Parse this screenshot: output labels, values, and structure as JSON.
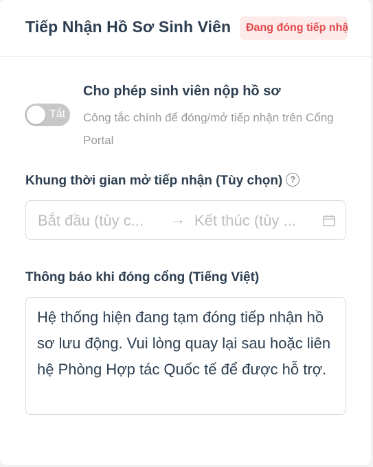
{
  "header": {
    "title": "Tiếp Nhận Hồ Sơ Sinh Viên",
    "status_badge": "Đang đóng tiếp nhận"
  },
  "toggle": {
    "state_label": "Tắt",
    "is_on": false
  },
  "option": {
    "title": "Cho phép sinh viên nộp hồ sơ",
    "description": "Công tắc chính để đóng/mở tiếp nhận trên Cổng Portal"
  },
  "time_window": {
    "label": "Khung thời gian mở tiếp nhận (Tùy chọn)",
    "start_placeholder": "Bắt đầu (tùy c...",
    "end_placeholder": "Kết thúc (tùy ..."
  },
  "closed_notice": {
    "label": "Thông báo khi đóng cổng (Tiếng Việt)",
    "value": "Hệ thống hiện đang tạm đóng tiếp nhận hồ sơ lưu động. Vui lòng quay lại sau hoặc liên hệ Phòng Hợp tác Quốc tế để được hỗ trợ."
  },
  "colors": {
    "badge_text": "#e24a4a",
    "badge_bg": "#fdeaea",
    "toggle_off": "#c7c7c7"
  },
  "icons": [
    "help-circle-icon",
    "calendar-icon",
    "arrow-right-icon"
  ]
}
